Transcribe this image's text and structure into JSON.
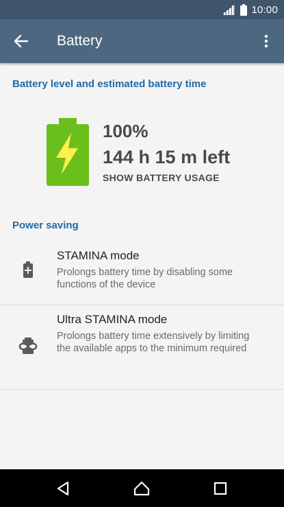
{
  "status_bar": {
    "time": "10:00",
    "signal_icon": "signal-icon",
    "battery_icon": "battery-icon"
  },
  "app_bar": {
    "title": "Battery",
    "back_icon": "arrow-back-icon",
    "menu_icon": "more-vert-icon"
  },
  "battery_section": {
    "header": "Battery level and estimated battery time",
    "percent": "100%",
    "time_left": "144 h 15 m left",
    "usage_link": "SHOW BATTERY USAGE",
    "icon": "battery-charging-icon"
  },
  "power_saving": {
    "header": "Power saving",
    "items": [
      {
        "title": "STAMINA mode",
        "description": "Prolongs battery time by disabling some functions of the device",
        "icon": "battery-plus-icon"
      },
      {
        "title": "Ultra STAMINA mode",
        "description": "Prolongs battery time extensively by limiting the available apps to the minimum required",
        "icon": "infinity-battery-icon"
      }
    ]
  },
  "colors": {
    "status_bar": "#3f556c",
    "app_bar": "#4d6781",
    "accent": "#1e6aa8",
    "battery_green": "#6bbf1d",
    "bolt": "#fff04a"
  },
  "nav_bar": {
    "back_icon": "nav-back-icon",
    "home_icon": "nav-home-icon",
    "recent_icon": "nav-recent-icon"
  }
}
